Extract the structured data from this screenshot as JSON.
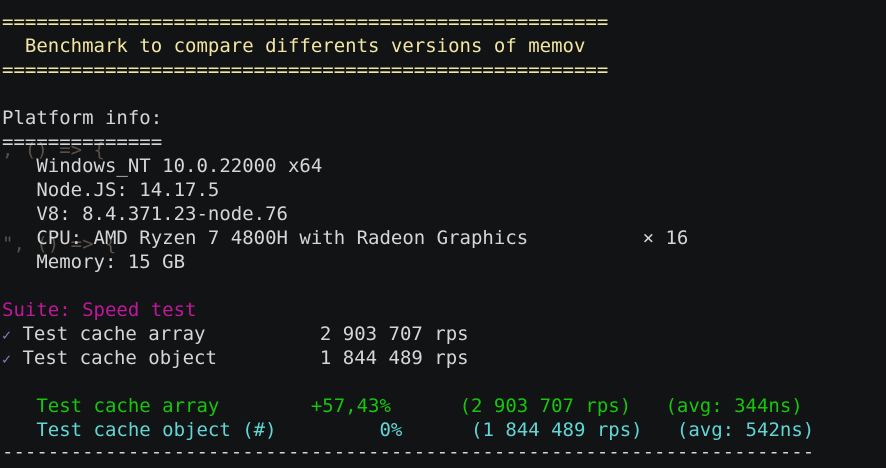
{
  "header": {
    "rule_top": "=====================================================",
    "title": "  Benchmark to compare differents versions of memov",
    "rule_bottom": "====================================================="
  },
  "platform": {
    "heading": "Platform info:",
    "rule": "==============",
    "os": "   Windows_NT 10.0.22000 x64",
    "node": "   Node.JS: 14.17.5",
    "v8": "   V8: 8.4.371.23-node.76",
    "cpu": "   CPU: AMD Ryzen 7 4800H with Radeon Graphics          × 16",
    "memory": "   Memory: 15 GB"
  },
  "ghost_text": {
    "line1": ", () => {",
    "line2": "\", () => {"
  },
  "suite": {
    "heading": "Suite: Speed test",
    "results": [
      {
        "check": "✓",
        "text": " Test cache array          2 903 707 rps"
      },
      {
        "check": "✓",
        "text": " Test cache object         1 844 489 rps"
      }
    ]
  },
  "summary": [
    {
      "name": "   Test cache array",
      "delta": "        +57,43%",
      "rps": "      (2 903 707 rps)",
      "avg": "   (avg: 344ns)"
    },
    {
      "name": "   Test cache object (#)",
      "delta": "         0%",
      "rps": "      (1 844 489 rps)",
      "avg": "   (avg: 542ns)"
    }
  ],
  "footer_rule": "-----------------------------------------------------------------------"
}
